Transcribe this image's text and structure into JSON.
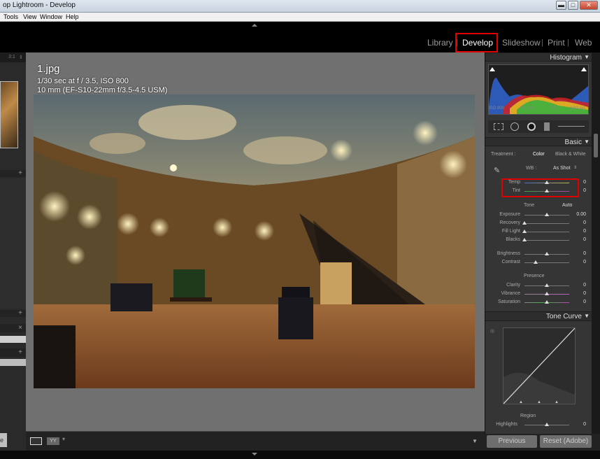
{
  "window": {
    "title": "op Lightroom - Develop",
    "btn_min": "▬",
    "btn_max": "□",
    "btn_close": "✕"
  },
  "menu": {
    "items": [
      "Tools",
      "View",
      "Window",
      "Help"
    ]
  },
  "modules": {
    "library": "Library",
    "develop": "Develop",
    "slideshow": "Slideshow",
    "print": "Print",
    "web": "Web",
    "sep": "|"
  },
  "left": {
    "fit": "3:1",
    "close": "×",
    "plus": "+",
    "button": "e"
  },
  "photo": {
    "filename": "1.jpg",
    "exposure_info": "1/30 sec at f / 3.5, ISO 800",
    "lens_info": "10 mm (EF-S10-22mm f/3.5-4.5 USM)"
  },
  "histogram": {
    "title": "Histogram",
    "iso": "ISO 800",
    "focal": "10 mm",
    "aperture": "f/3.5",
    "shutter": "1/30 sec"
  },
  "basic": {
    "title": "Basic",
    "treatment_label": "Treatment :",
    "treatment_color": "Color",
    "treatment_bw": "Black & White",
    "wb_label": "WB :",
    "wb_value": "As Shot",
    "temp": {
      "label": "Temp",
      "value": "0",
      "level": 0.5
    },
    "tint": {
      "label": "Tint",
      "value": "0",
      "level": 0.5
    },
    "tone_label": "Tone",
    "auto_label": "Auto",
    "exposure": {
      "label": "Exposure",
      "value": "0.00",
      "level": 0.5
    },
    "recovery": {
      "label": "Recovery",
      "value": "0",
      "level": 0.0
    },
    "fill_light": {
      "label": "Fill Light",
      "value": "0",
      "level": 0.0
    },
    "blacks": {
      "label": "Blacks",
      "value": "0",
      "level": 0.0
    },
    "brightness": {
      "label": "Brightness",
      "value": "0",
      "level": 0.5
    },
    "contrast": {
      "label": "Contrast",
      "value": "0",
      "level": 0.25
    },
    "presence_label": "Presence",
    "clarity": {
      "label": "Clarity",
      "value": "0",
      "level": 0.5
    },
    "vibrance": {
      "label": "Vibrance",
      "value": "0",
      "level": 0.5
    },
    "saturation": {
      "label": "Saturation",
      "value": "0",
      "level": 0.5
    }
  },
  "tone_curve": {
    "title": "Tone Curve",
    "region_label": "Region",
    "highlights": {
      "label": "Highlights",
      "value": "0",
      "level": 0.5
    }
  },
  "buttons": {
    "previous": "Previous",
    "reset": "Reset (Adobe)"
  },
  "colors": {
    "highlight_box": "#e00000",
    "panel": "#353535",
    "center_bg": "#707070"
  }
}
